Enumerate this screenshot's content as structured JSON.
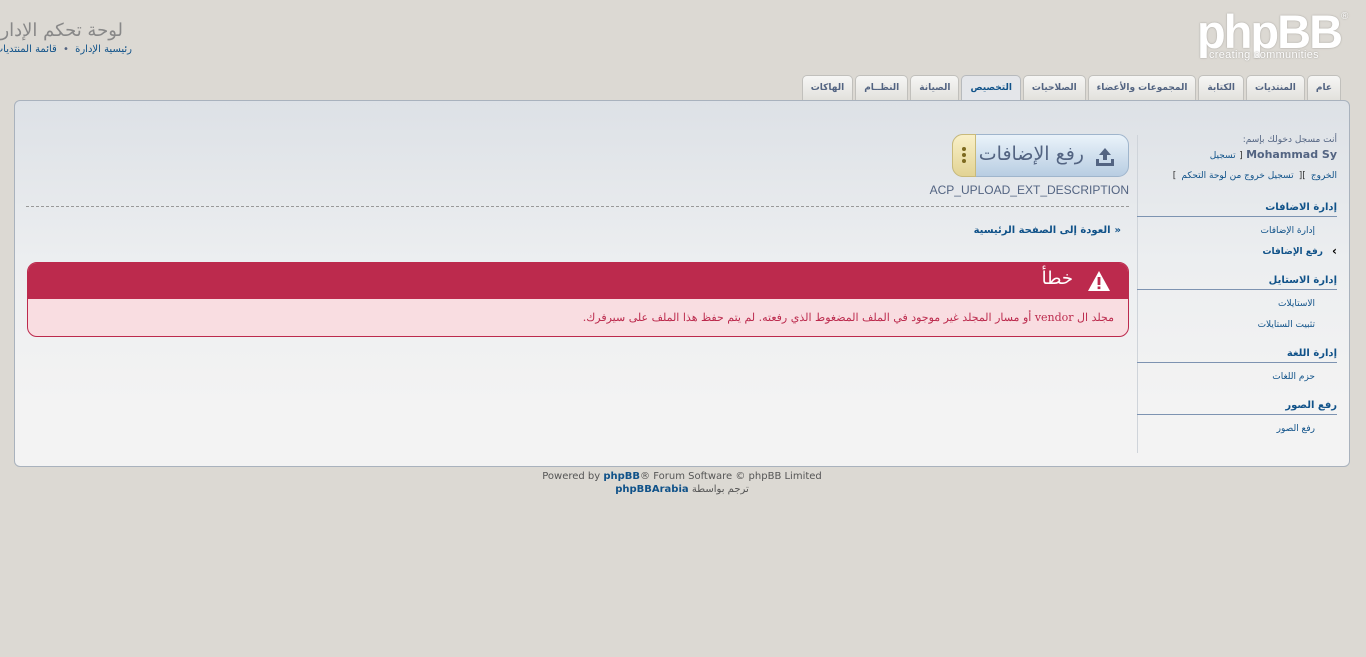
{
  "header": {
    "logo_text": "phpBB",
    "logo_reg": "®",
    "logo_tagline": "creating communities",
    "site_title": "لوحة تحكم الإدارة",
    "breadcrumbs": [
      "رئيسية الإدارة",
      "قائمة المنتديات"
    ],
    "breadcrumb_sep": "•"
  },
  "tabs": [
    {
      "label": "عام",
      "active": false
    },
    {
      "label": "المنتديات",
      "active": false
    },
    {
      "label": "الكتابة",
      "active": false
    },
    {
      "label": "المجموعات والأعضاء",
      "active": false
    },
    {
      "label": "الصلاحيات",
      "active": false
    },
    {
      "label": "التخصيص",
      "active": true
    },
    {
      "label": "الصيانة",
      "active": false
    },
    {
      "label": "النظــام",
      "active": false
    },
    {
      "label": "الهاكات",
      "active": false
    }
  ],
  "sidebar": {
    "login_note": "أنت مسجل دخولك بإسم:",
    "username": "Mohammad Sy",
    "register_link": "تسجيل",
    "logout_link": "الخروج",
    "acp_logout_link": "تسجيل خروج من لوحة التحكم",
    "sections": [
      {
        "title": "إدارة الاضافات",
        "items": [
          {
            "label": "إدارة الإضافات",
            "active": false
          },
          {
            "label": "رفع الإضافات",
            "active": true
          }
        ]
      },
      {
        "title": "إدارة الاستايل",
        "items": [
          {
            "label": "الاستايلات",
            "active": false
          },
          {
            "label": "تثبيت الستايلات",
            "active": false
          }
        ]
      },
      {
        "title": "إدارة اللغة",
        "items": [
          {
            "label": "حزم اللغات",
            "active": false
          }
        ]
      },
      {
        "title": "رفع الصور",
        "items": [
          {
            "label": "رفع الصور",
            "active": false
          }
        ]
      }
    ]
  },
  "main": {
    "title": "رفع الإضافات",
    "description": "ACP_UPLOAD_EXT_DESCRIPTION",
    "back_link": "العودة إلى الصفحة الرئيسية",
    "back_arrows": "«",
    "error": {
      "title": "خطأ",
      "message": "مجلد ال vendor أو مسار المجلد غير موجود في الملف المضغوط الذي رفعته. لم يتم حفظ هذا الملف على سيرفرك."
    }
  },
  "footer": {
    "powered_prefix": "Powered by ",
    "powered_brand": "phpBB",
    "powered_suffix": "® Forum Software © phpBB Limited",
    "translated_by": "ترجم بواسطة",
    "translator": "phpBBArabia"
  },
  "colors": {
    "link": "#105289",
    "text": "#536482",
    "error": "#bc2a4d",
    "error_bg": "#f9dde1",
    "page_bg": "#dcd9d3"
  },
  "icons": {
    "title": "upload-icon",
    "error": "warning-icon",
    "active_menu": "chevron-icon"
  }
}
